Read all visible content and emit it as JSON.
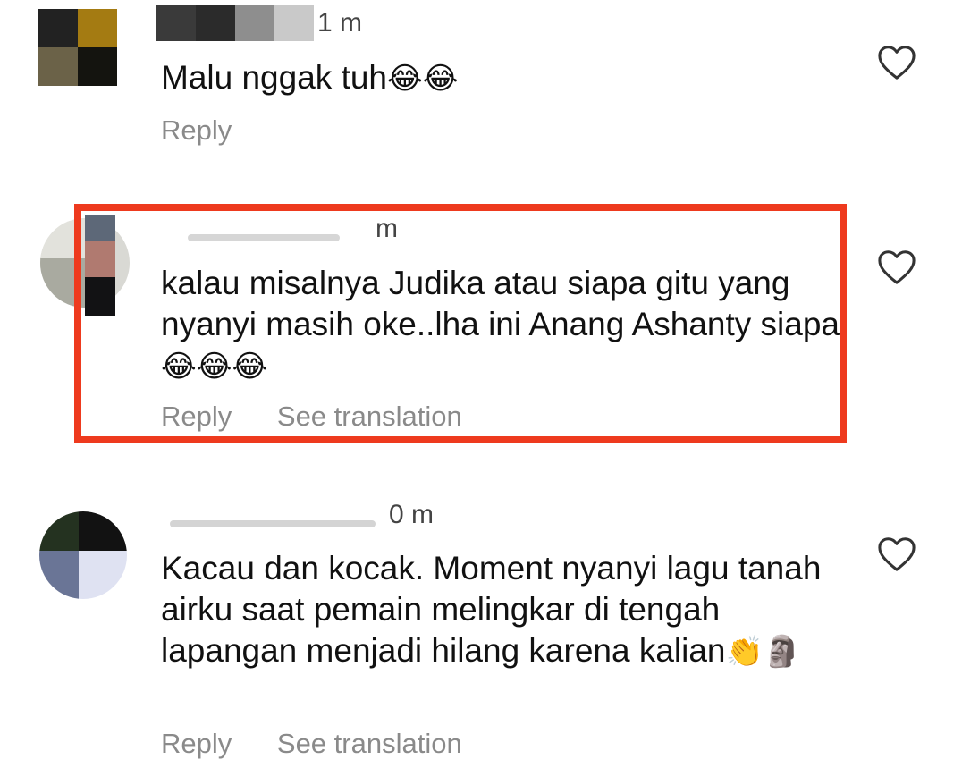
{
  "comments": [
    {
      "time": "1 m",
      "text": "Malu nggak tuh",
      "emojis": "😂😂",
      "actions": [
        "Reply"
      ]
    },
    {
      "time": "m",
      "text": "kalau misalnya Judika atau siapa gitu yang nyanyi masih oke..lha ini Anang Ashanty siapa",
      "emojis": "😂😂😂",
      "actions": [
        "Reply",
        "See translation"
      ]
    },
    {
      "time": "0 m",
      "text": "Kacau dan kocak. Moment nyanyi lagu tanah airku saat pemain melingkar di tengah lapangan menjadi hilang karena kalian",
      "emojis": "👏🗿",
      "actions": [
        "Reply",
        "See translation"
      ]
    }
  ],
  "colors": {
    "highlight": "#ee3a1e",
    "action_text": "#8a8a8a",
    "like_icon": "#333333"
  },
  "icons": {
    "like": "heart-outline-icon"
  }
}
